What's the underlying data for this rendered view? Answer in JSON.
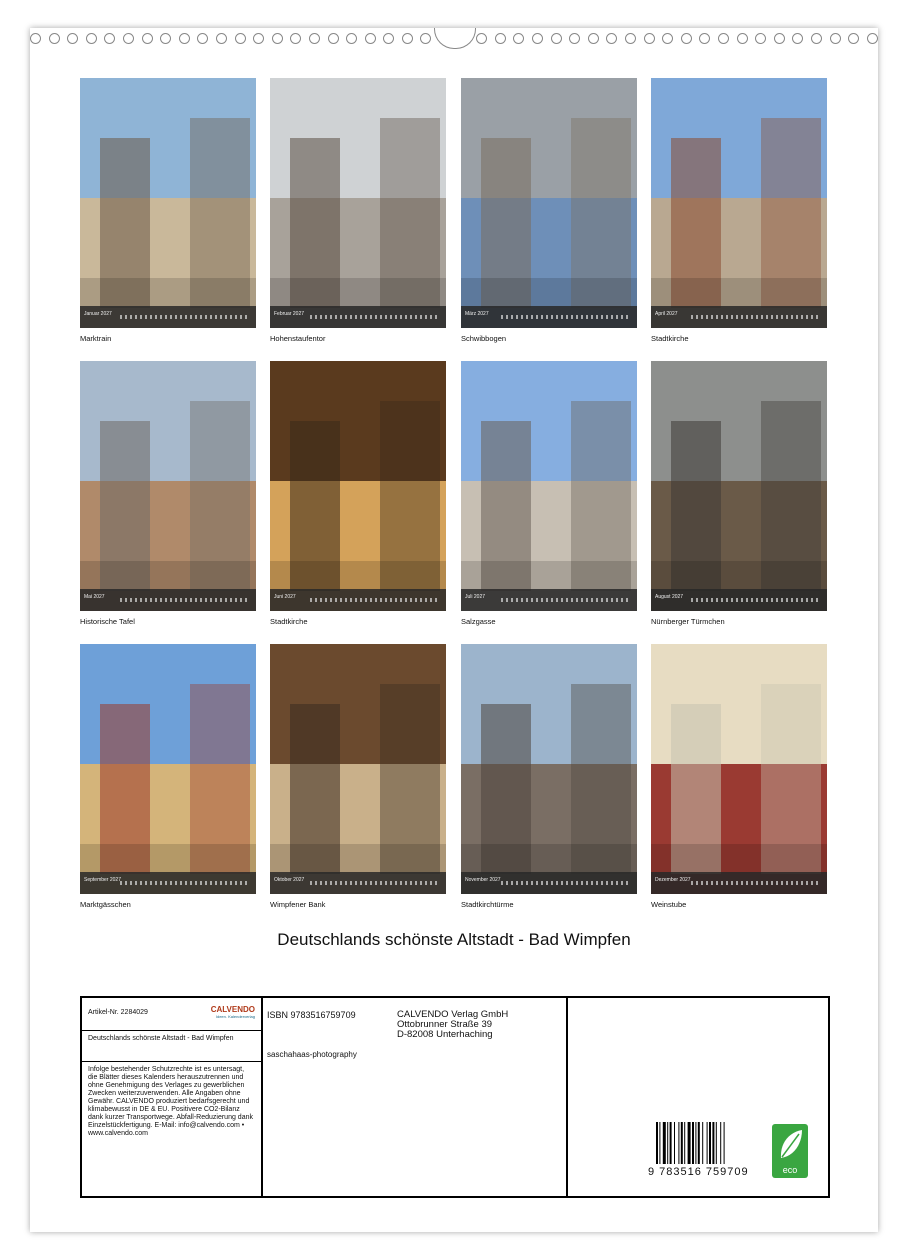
{
  "months": [
    {
      "month": "Januar 2027",
      "caption": "Marktrain"
    },
    {
      "month": "Februar 2027",
      "caption": "Hohenstaufentor"
    },
    {
      "month": "März 2027",
      "caption": "Schwibbogen"
    },
    {
      "month": "April 2027",
      "caption": "Stadtkirche"
    },
    {
      "month": "Mai 2027",
      "caption": "Historische Tafel"
    },
    {
      "month": "Juni 2027",
      "caption": "Stadtkirche"
    },
    {
      "month": "Juli 2027",
      "caption": "Salzgasse"
    },
    {
      "month": "August 2027",
      "caption": "Nürnberger Türmchen"
    },
    {
      "month": "September 2027",
      "caption": "Marktgässchen"
    },
    {
      "month": "Oktober 2027",
      "caption": "Wimpfener Bank"
    },
    {
      "month": "November 2027",
      "caption": "Stadtkirchtürme"
    },
    {
      "month": "Dezember 2027",
      "caption": "Weinstube"
    }
  ],
  "title": "Deutschlands schönste Altstadt - Bad Wimpfen",
  "info": {
    "article_label": "Artikel-Nr.  2284029",
    "logo": "CALVENDO",
    "logo_sub": "Ideen. Kalenderverlag",
    "product_title": "Deutschlands schönste Altstadt - Bad Wimpfen",
    "legal": "Infolge bestehender Schutzrechte ist es untersagt, die Blätter dieses Kalenders herauszutrennen und ohne Genehmigung des Verlages zu gewerblichen Zwecken weiterzuverwenden. Alle Angaben ohne Gewähr. CALVENDO produziert bedarfsgerecht und klimabewusst in DE & EU. Positivere CO2-Bilanz dank kurzer Transportwege. Abfall-Reduzierung dank Einzelstückfertigung. E-Mail: info@calvendo.com • www.calvendo.com",
    "isbn": "ISBN 9783516759709",
    "author": "saschahaas-photography",
    "publisher_name": "CALVENDO Verlag GmbH",
    "publisher_street": "Ottobrunner Straße 39",
    "publisher_city": "D-82008 Unterhaching",
    "barcode_digits": "9 783516 759709",
    "eco_label": "eco"
  }
}
